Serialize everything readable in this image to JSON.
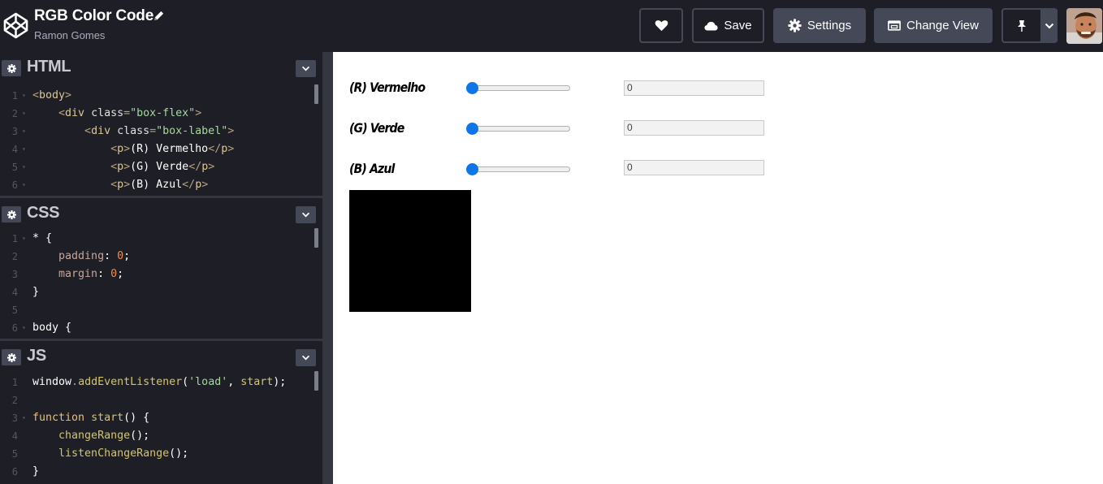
{
  "header": {
    "title": "RGB Color Code",
    "author": "Ramon Gomes",
    "save_label": "Save",
    "settings_label": "Settings",
    "change_view_label": "Change View"
  },
  "editors": {
    "html": {
      "name": "HTML",
      "lines": [
        {
          "n": "1",
          "fold": true,
          "parts": [
            [
              "t-tagg",
              "<"
            ],
            [
              "t-tag",
              "body"
            ],
            [
              "t-tagg",
              ">"
            ]
          ]
        },
        {
          "n": "2",
          "fold": true,
          "parts": [
            [
              "",
              "    "
            ],
            [
              "t-tagg",
              "<"
            ],
            [
              "t-tag",
              "div "
            ],
            [
              "t-attr",
              "class"
            ],
            [
              "t-tagg",
              "="
            ],
            [
              "t-str",
              "\"box-flex\""
            ],
            [
              "t-tagg",
              ">"
            ]
          ]
        },
        {
          "n": "3",
          "fold": true,
          "parts": [
            [
              "",
              "        "
            ],
            [
              "t-tagg",
              "<"
            ],
            [
              "t-tag",
              "div "
            ],
            [
              "t-attr",
              "class"
            ],
            [
              "t-tagg",
              "="
            ],
            [
              "t-str",
              "\"box-label\""
            ],
            [
              "t-tagg",
              ">"
            ]
          ]
        },
        {
          "n": "4",
          "fold": true,
          "parts": [
            [
              "",
              "            "
            ],
            [
              "t-tagg",
              "<"
            ],
            [
              "t-tag",
              "p"
            ],
            [
              "t-tagg",
              ">"
            ],
            [
              "",
              "(R) Vermelho"
            ],
            [
              "t-tagg",
              "</"
            ],
            [
              "t-tag",
              "p"
            ],
            [
              "t-tagg",
              ">"
            ]
          ]
        },
        {
          "n": "5",
          "fold": true,
          "parts": [
            [
              "",
              "            "
            ],
            [
              "t-tagg",
              "<"
            ],
            [
              "t-tag",
              "p"
            ],
            [
              "t-tagg",
              ">"
            ],
            [
              "",
              "(G) Verde"
            ],
            [
              "t-tagg",
              "</"
            ],
            [
              "t-tag",
              "p"
            ],
            [
              "t-tagg",
              ">"
            ]
          ]
        },
        {
          "n": "6",
          "fold": true,
          "parts": [
            [
              "",
              "            "
            ],
            [
              "t-tagg",
              "<"
            ],
            [
              "t-tag",
              "p"
            ],
            [
              "t-tagg",
              ">"
            ],
            [
              "",
              "(B) Azul"
            ],
            [
              "t-tagg",
              "</"
            ],
            [
              "t-tag",
              "p"
            ],
            [
              "t-tagg",
              ">"
            ]
          ]
        }
      ]
    },
    "css": {
      "name": "CSS",
      "lines": [
        {
          "n": "1",
          "fold": true,
          "parts": [
            [
              "",
              "* {"
            ]
          ]
        },
        {
          "n": "2",
          "fold": false,
          "parts": [
            [
              "",
              "    "
            ],
            [
              "t-prop",
              "padding"
            ],
            [
              "",
              ": "
            ],
            [
              "t-num",
              "0"
            ],
            [
              "",
              ";"
            ]
          ]
        },
        {
          "n": "3",
          "fold": false,
          "parts": [
            [
              "",
              "    "
            ],
            [
              "t-prop",
              "margin"
            ],
            [
              "",
              ": "
            ],
            [
              "t-num",
              "0"
            ],
            [
              "",
              ";"
            ]
          ]
        },
        {
          "n": "4",
          "fold": false,
          "parts": [
            [
              "",
              "}"
            ]
          ]
        },
        {
          "n": "5",
          "fold": false,
          "parts": [
            [
              "",
              ""
            ]
          ]
        },
        {
          "n": "6",
          "fold": true,
          "parts": [
            [
              "",
              "body {"
            ]
          ]
        }
      ]
    },
    "js": {
      "name": "JS",
      "lines": [
        {
          "n": "1",
          "fold": false,
          "parts": [
            [
              "",
              "window"
            ],
            [
              "t-dot",
              "."
            ],
            [
              "t-fn",
              "addEventListener"
            ],
            [
              "",
              "("
            ],
            [
              "t-jsstr",
              "'load'"
            ],
            [
              "",
              ", "
            ],
            [
              "t-fn",
              "start"
            ],
            [
              "",
              ");"
            ]
          ]
        },
        {
          "n": "2",
          "fold": false,
          "parts": [
            [
              "",
              ""
            ]
          ]
        },
        {
          "n": "3",
          "fold": true,
          "parts": [
            [
              "t-kw",
              "function "
            ],
            [
              "t-fn",
              "start"
            ],
            [
              "",
              "() {"
            ]
          ]
        },
        {
          "n": "4",
          "fold": false,
          "parts": [
            [
              "",
              "    "
            ],
            [
              "t-fn",
              "changeRange"
            ],
            [
              "",
              "();"
            ]
          ]
        },
        {
          "n": "5",
          "fold": false,
          "parts": [
            [
              "",
              "    "
            ],
            [
              "t-fn",
              "listenChangeRange"
            ],
            [
              "",
              "();"
            ]
          ]
        },
        {
          "n": "6",
          "fold": false,
          "parts": [
            [
              "",
              "}"
            ]
          ]
        }
      ]
    }
  },
  "preview": {
    "rows": [
      {
        "label": "(R) Vermelho",
        "value": "0",
        "slider_fraction": 0
      },
      {
        "label": "(G) Verde",
        "value": "0",
        "slider_fraction": 0
      },
      {
        "label": "(B) Azul",
        "value": "0",
        "slider_fraction": 0
      }
    ],
    "color_box": "#000000"
  },
  "colors": {
    "accent": "#0f76e9",
    "chrome": "#1e1f26",
    "button": "#444857"
  },
  "icons": [
    "codepen-logo-icon",
    "pencil-icon",
    "heart-icon",
    "cloud-icon",
    "gear-icon",
    "change-view-icon",
    "pin-icon",
    "chevron-down-icon"
  ]
}
